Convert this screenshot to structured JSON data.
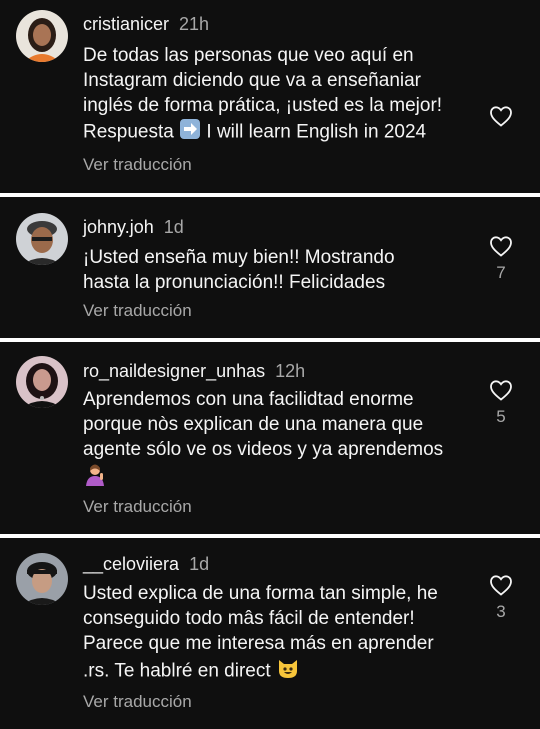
{
  "comments": [
    {
      "username": "cristianicer",
      "time": "21h",
      "lines": [
        "De todas las personas que veo aquí en",
        "Instagram diciendo que va a enseñaniar",
        "inglés de forma prática, ¡usted es la mejor!"
      ],
      "reply_prefix": "Respuesta",
      "reply_suffix": "I will learn English in 2024",
      "translate": "Ver traducción",
      "likes": ""
    },
    {
      "username": "johny.joh",
      "time": "1d",
      "lines": [
        "¡Usted enseña muy bien!! Mostrando",
        "hasta la pronunciación!! Felicidades"
      ],
      "translate": "Ver traducción",
      "likes": "7"
    },
    {
      "username": "ro_naildesigner_unhas",
      "time": "12h",
      "lines": [
        "Aprendemos con una facilidtad enorme",
        "porque nòs explican de una manera que",
        "agente sólo ve os videos y ya aprendemos"
      ],
      "translate": "Ver traducción",
      "likes": "5"
    },
    {
      "username": "__celoviiera",
      "time": "1d",
      "lines": [
        "Usted explica de una forma tan simple, he",
        "conseguido todo mâs fácil de entender!",
        "Parece que me interesa más en aprender"
      ],
      "last_line": ".rs. Te hablré en direct",
      "translate": "Ver traducción",
      "likes": "3"
    }
  ],
  "icons": {
    "like": "heart-outline-icon",
    "reply_arrow": "arrow-right-emoji-icon",
    "woman_gesture": "woman-gesturing-emoji-icon",
    "cat_smile": "smiling-cat-emoji-icon"
  }
}
